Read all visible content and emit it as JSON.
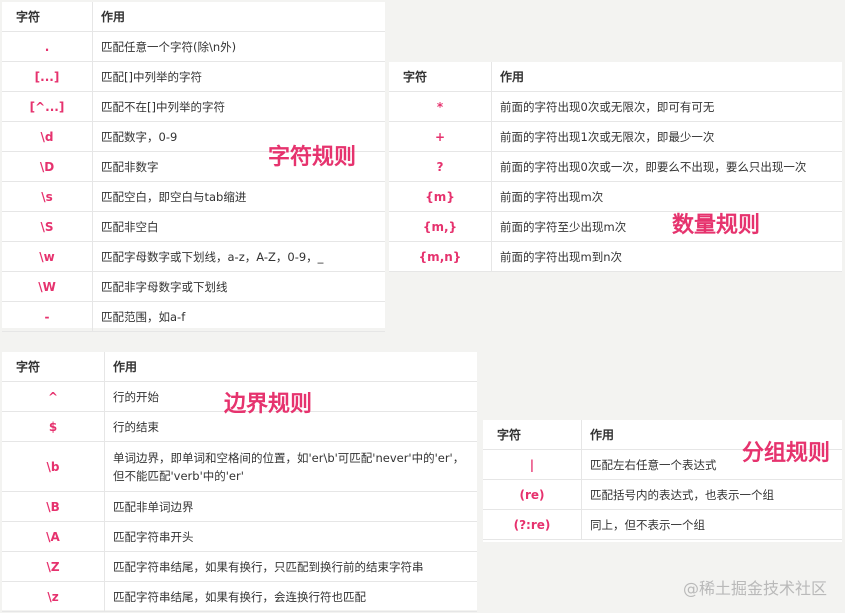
{
  "header": {
    "char": "字符",
    "use": "作用"
  },
  "panels": {
    "char_rules": {
      "label": "字符规则",
      "rows": [
        {
          "ch": ".",
          "desc": "匹配任意一个字符(除\\n外)"
        },
        {
          "ch": "[...]",
          "desc": "匹配[]中列举的字符"
        },
        {
          "ch": "[^...]",
          "desc": "匹配不在[]中列举的字符"
        },
        {
          "ch": "\\d",
          "desc": "匹配数字，0-9"
        },
        {
          "ch": "\\D",
          "desc": "匹配非数字"
        },
        {
          "ch": "\\s",
          "desc": "匹配空白，即空白与tab缩进"
        },
        {
          "ch": "\\S",
          "desc": "匹配非空白"
        },
        {
          "ch": "\\w",
          "desc": "匹配字母数字或下划线，a-z，A-Z，0-9，_"
        },
        {
          "ch": "\\W",
          "desc": "匹配非字母数字或下划线"
        },
        {
          "ch": "-",
          "desc": "匹配范围，如a-f"
        }
      ]
    },
    "quantity_rules": {
      "label": "数量规则",
      "rows": [
        {
          "ch": "*",
          "desc": "前面的字符出现0次或无限次，即可有可无"
        },
        {
          "ch": "+",
          "desc": "前面的字符出现1次或无限次，即最少一次"
        },
        {
          "ch": "?",
          "desc": "前面的字符出现0次或一次，即要么不出现，要么只出现一次"
        },
        {
          "ch": "{m}",
          "desc": "前面的字符出现m次"
        },
        {
          "ch": "{m,}",
          "desc": "前面的字符至少出现m次"
        },
        {
          "ch": "{m,n}",
          "desc": "前面的字符出现m到n次"
        }
      ]
    },
    "boundary_rules": {
      "label": "边界规则",
      "rows": [
        {
          "ch": "^",
          "desc": "行的开始"
        },
        {
          "ch": "$",
          "desc": "行的结束"
        },
        {
          "ch": "\\b",
          "desc": "单词边界，即单词和空格间的位置，如'er\\b'可匹配'never'中的'er'，但不能匹配'verb'中的'er'"
        },
        {
          "ch": "\\B",
          "desc": "匹配非单词边界"
        },
        {
          "ch": "\\A",
          "desc": "匹配字符串开头"
        },
        {
          "ch": "\\Z",
          "desc": "匹配字符串结尾，如果有换行，只匹配到换行前的结束字符串"
        },
        {
          "ch": "\\z",
          "desc": "匹配字符串结尾，如果有换行，会连换行符也匹配"
        }
      ]
    },
    "group_rules": {
      "label": "分组规则",
      "rows": [
        {
          "ch": "|",
          "desc": "匹配左右任意一个表达式"
        },
        {
          "ch": "(re)",
          "desc": "匹配括号内的表达式，也表示一个组"
        },
        {
          "ch": "(?:re)",
          "desc": "同上，但不表示一个组"
        }
      ]
    }
  },
  "watermark": "@稀土掘金技术社区"
}
